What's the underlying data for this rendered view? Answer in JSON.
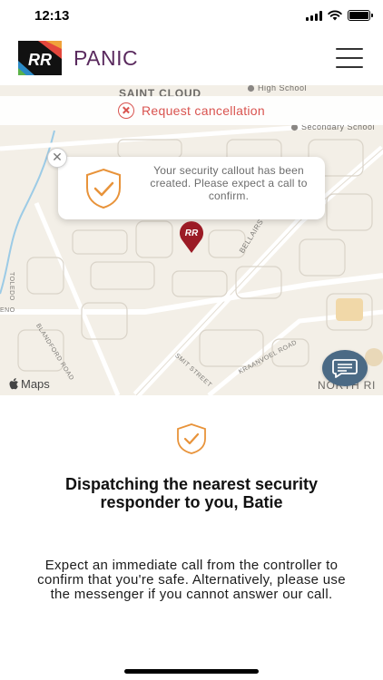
{
  "status_bar": {
    "time": "12:13"
  },
  "header": {
    "title": "PANIC",
    "logo_text": "RR"
  },
  "map": {
    "cancel_label": "Request cancellation",
    "callout_text": "Your security callout has been created. Please expect a call to confirm.",
    "labels": {
      "saint_cloud": "SAINT CLOUD",
      "high_school": "High School",
      "secondary_school": "Secondary School",
      "bellairs_drive": "BELLAIRS DRIVE",
      "toledo": "TOLEDO",
      "blandford_road": "BLANDFORD ROAD",
      "smit_street": "SMIT STREET",
      "kraanvoel_road": "KRAANVOEL ROAD",
      "north_ri": "NORTH RI",
      "eno": "ENO"
    },
    "attribution": "Maps",
    "pin_text": "RR"
  },
  "panel": {
    "heading": "Dispatching the nearest security responder to you, Batie",
    "body": "Expect an immediate call from the controller to confirm that you're safe. Alternatively, please use the messenger if you cannot answer our call."
  },
  "colors": {
    "brand_purple": "#5a2a5e",
    "danger_red": "#d9534f",
    "shield_orange": "#e8933a",
    "pin_red": "#9b1b25",
    "chat_blue": "#4b6a85"
  }
}
